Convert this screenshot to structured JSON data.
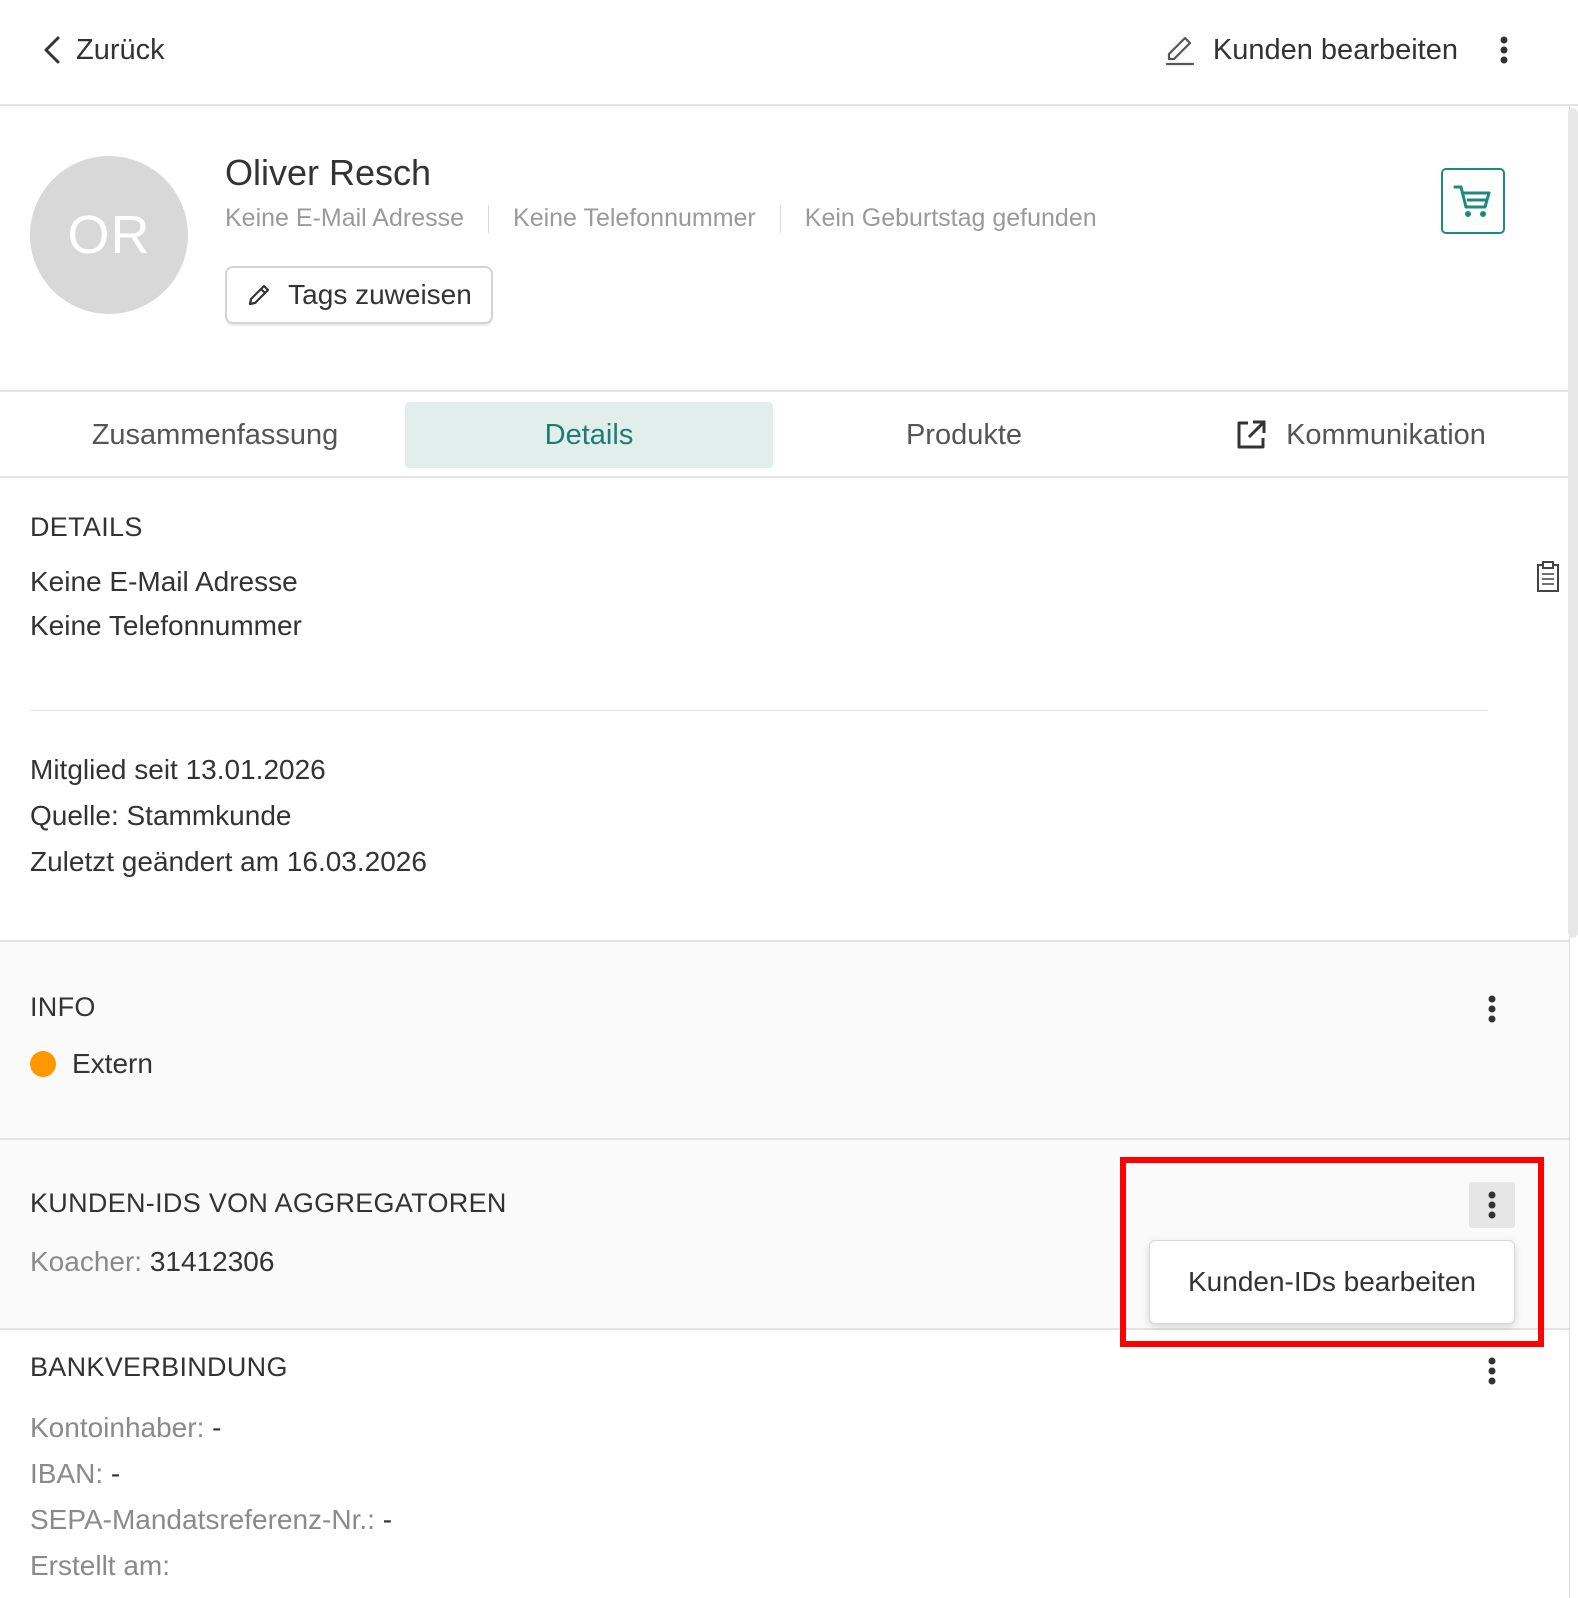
{
  "topbar": {
    "back_label": "Zurück",
    "edit_label": "Kunden bearbeiten"
  },
  "profile": {
    "initials": "OR",
    "name": "Oliver Resch",
    "email": "Keine E-Mail Adresse",
    "phone": "Keine Telefonnummer",
    "birthday": "Kein Geburtstag gefunden",
    "tags_button": "Tags zuweisen"
  },
  "tabs": [
    {
      "label": "Zusammenfassung"
    },
    {
      "label": "Details"
    },
    {
      "label": "Produkte"
    },
    {
      "label": "Kommunikation"
    }
  ],
  "details": {
    "title": "DETAILS",
    "email": "Keine E-Mail Adresse",
    "phone": "Keine Telefonnummer",
    "member_since": "Mitglied seit 13.01.2026",
    "source": "Quelle: Stammkunde",
    "last_changed": "Zuletzt geändert am 16.03.2026"
  },
  "info": {
    "title": "INFO",
    "status": "Extern",
    "status_color": "#ff9800"
  },
  "aggregators": {
    "title": "KUNDEN-IDS VON AGGREGATOREN",
    "key": "Koacher:",
    "value": "31412306",
    "menu_item": "Kunden-IDs bearbeiten"
  },
  "bank": {
    "title": "BANKVERBINDUNG",
    "owner_key": "Kontoinhaber:",
    "owner_value": "-",
    "iban_key": "IBAN:",
    "iban_value": "-",
    "sepa_key": "SEPA-Mandatsreferenz-Nr.:",
    "sepa_value": "-",
    "created_key": "Erstellt am:"
  },
  "colors": {
    "accent": "#1e8a7b",
    "active_tab_bg": "#e1eeeb",
    "highlight": "#ff0000"
  }
}
